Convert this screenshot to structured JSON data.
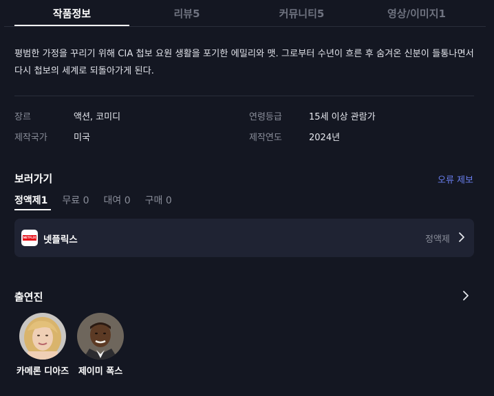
{
  "tabs": [
    {
      "label": "작품정보"
    },
    {
      "label": "리뷰5"
    },
    {
      "label": "커뮤니티5"
    },
    {
      "label": "영상/이미지1"
    }
  ],
  "synopsis": "평범한 가정을 꾸리기 위해 CIA 첩보 요원 생활을 포기한 에밀리와 맷. 그로부터 수년이 흐른 후 숨겨온 신분이 들통나면서 다시 첩보의 세계로 되돌아가게 된다.",
  "info": {
    "genre": {
      "label": "장르",
      "value": "액션, 코미디"
    },
    "rating": {
      "label": "연령등급",
      "value": "15세 이상 관람가"
    },
    "country": {
      "label": "제작국가",
      "value": "미국"
    },
    "year": {
      "label": "제작연도",
      "value": "2024년"
    }
  },
  "watch": {
    "title": "보러가기",
    "report": "오류 제보",
    "filters": [
      {
        "label": "정액제",
        "count": "1"
      },
      {
        "label": "무료",
        "count": "0"
      },
      {
        "label": "대여",
        "count": "0"
      },
      {
        "label": "구매",
        "count": "0"
      }
    ],
    "provider": {
      "logo_text": "NETFLIX",
      "name": "넷플릭스",
      "type": "정액제"
    }
  },
  "cast": {
    "title": "출연진",
    "members": [
      {
        "name": "카메론 디아즈"
      },
      {
        "name": "제이미 폭스"
      }
    ]
  },
  "colors": {
    "background": "#141722",
    "card": "#1f2333",
    "accent_link": "#6a7ff0",
    "netflix_red": "#e50914"
  }
}
